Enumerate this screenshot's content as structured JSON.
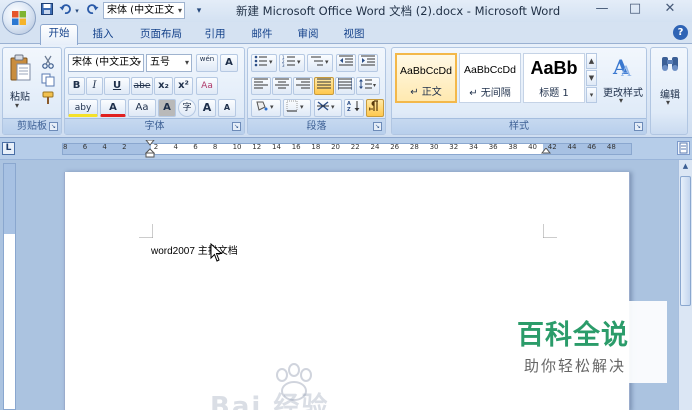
{
  "window": {
    "title": "新建 Microsoft Office Word 文档 (2).docx - Microsoft Word",
    "minimize": "—",
    "maximize": "□",
    "close": "✕"
  },
  "qat": {
    "font_box": "宋体 (中文正文",
    "customize_arrow": "▾"
  },
  "tabs": [
    {
      "label": "开始",
      "active": true
    },
    {
      "label": "插入"
    },
    {
      "label": "页面布局"
    },
    {
      "label": "引用"
    },
    {
      "label": "邮件"
    },
    {
      "label": "审阅"
    },
    {
      "label": "视图"
    }
  ],
  "help": "?",
  "clipboard": {
    "group_label": "剪贴板",
    "paste_label": "粘贴"
  },
  "font": {
    "group_label": "字体",
    "font_name": "宋体 (中文正文",
    "font_size": "五号",
    "pinyin": "wén",
    "border_char": "A",
    "bold": "B",
    "italic": "I",
    "underline": "U",
    "strike": "abe",
    "subscript": "x₂",
    "superscript": "x²",
    "clear_format": "Aa",
    "highlight": "aby",
    "font_color": "A",
    "change_case": "Aa",
    "char_shading": "A",
    "enclose": "字",
    "grow": "A",
    "shrink": "A"
  },
  "paragraph": {
    "group_label": "段落"
  },
  "styles": {
    "group_label": "样式",
    "items": [
      {
        "sample": "AaBbCcDd",
        "name": "↵ 正文"
      },
      {
        "sample": "AaBbCcDd",
        "name": "↵ 无间隔"
      },
      {
        "sample": "AaBb",
        "name": "标题 1"
      }
    ],
    "change_styles": "更改样式"
  },
  "editing": {
    "label": "编辑"
  },
  "ruler": {
    "corner": "L",
    "numbers": [
      "8",
      "6",
      "4",
      "2",
      "2",
      "4",
      "6",
      "8",
      "10",
      "12",
      "14",
      "16",
      "18",
      "20",
      "22",
      "24",
      "26",
      "28",
      "30",
      "32",
      "34",
      "36",
      "38",
      "40",
      "42",
      "44",
      "46",
      "48"
    ]
  },
  "document": {
    "text": "word2007 主排文档"
  },
  "watermark": {
    "title": "百科全说",
    "subtitle": "助你轻松解决",
    "bottom": "Bai 经验"
  }
}
